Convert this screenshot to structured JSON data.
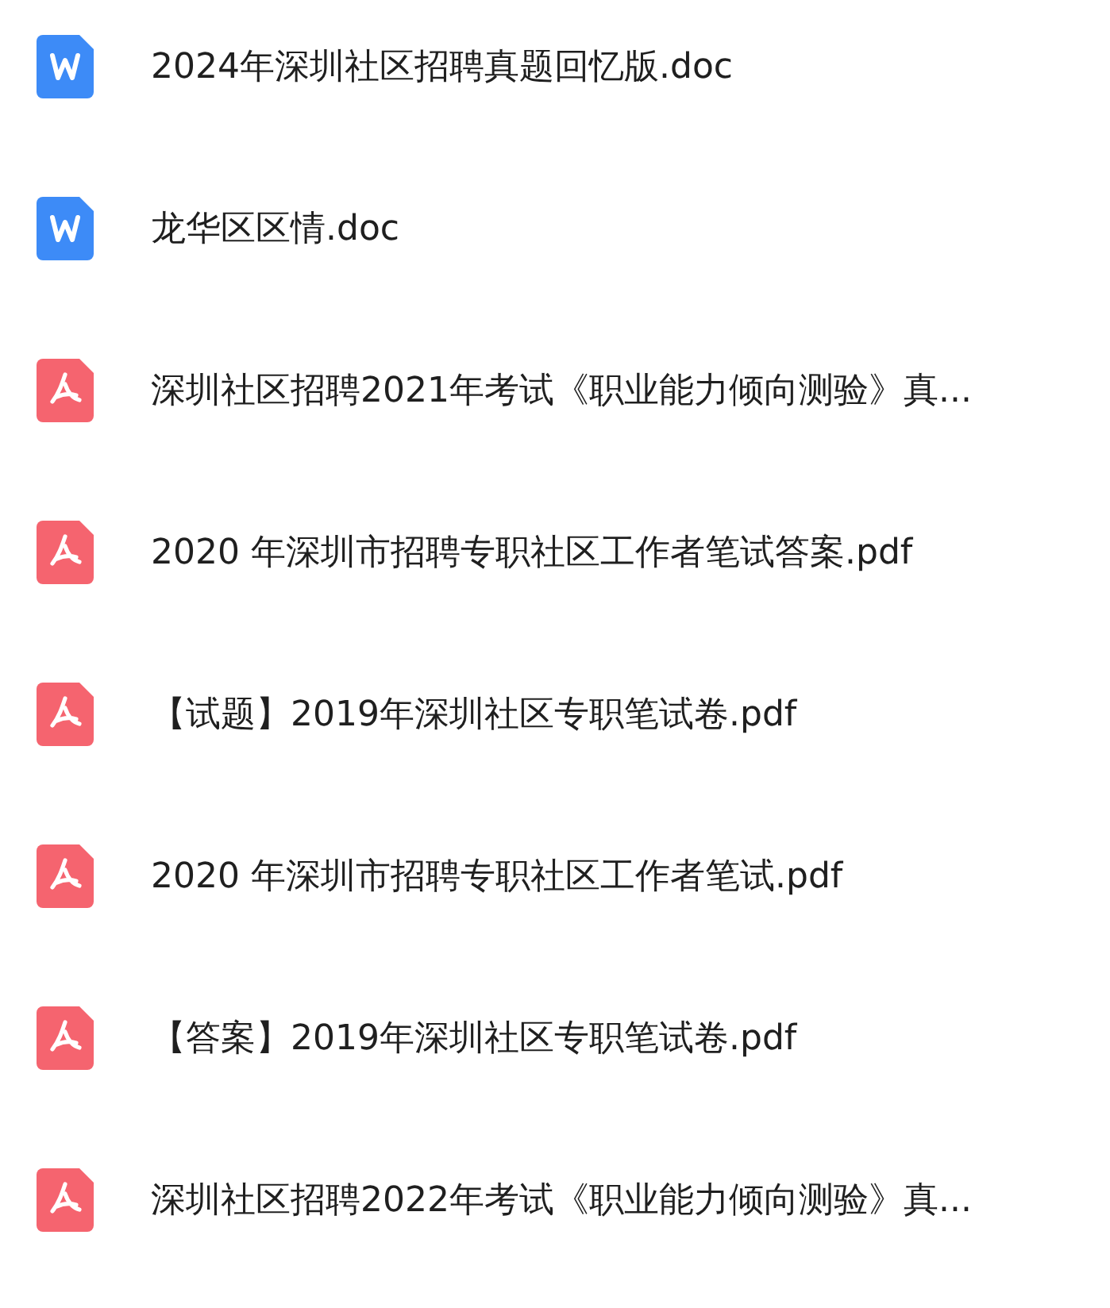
{
  "files": [
    {
      "kind": "doc",
      "name": "2024年深圳社区招聘真题回忆版.doc"
    },
    {
      "kind": "doc",
      "name": "龙华区区情.doc"
    },
    {
      "kind": "pdf",
      "name": "深圳社区招聘2021年考试《职业能力倾向测验》真..."
    },
    {
      "kind": "pdf",
      "name": "2020 年深圳市招聘专职社区工作者笔试答案.pdf"
    },
    {
      "kind": "pdf",
      "name": "【试题】2019年深圳社区专职笔试卷.pdf"
    },
    {
      "kind": "pdf",
      "name": "2020 年深圳市招聘专职社区工作者笔试.pdf"
    },
    {
      "kind": "pdf",
      "name": "【答案】2019年深圳社区专职笔试卷.pdf"
    },
    {
      "kind": "pdf",
      "name": "深圳社区招聘2022年考试《职业能力倾向测验》真..."
    }
  ]
}
